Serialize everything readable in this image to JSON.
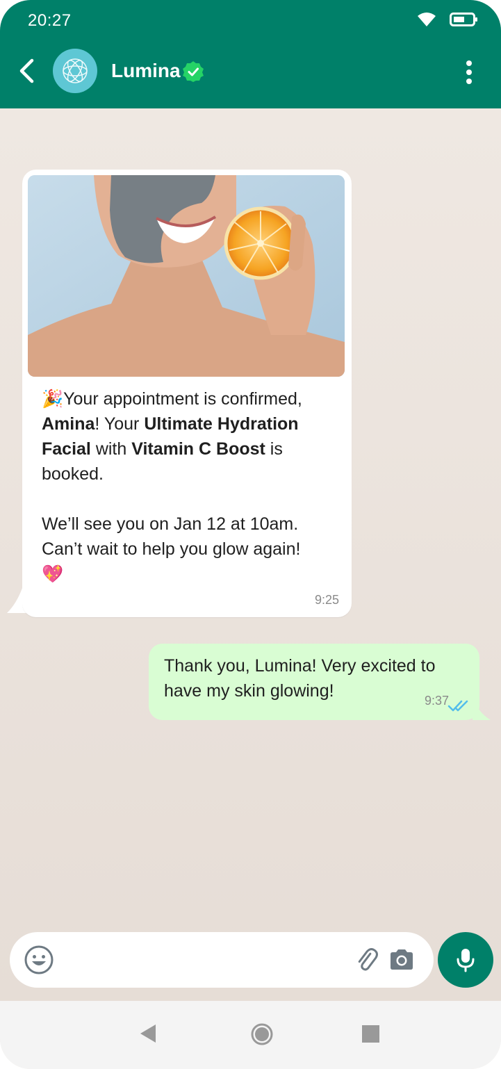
{
  "status_bar": {
    "time": "20:27",
    "icons": [
      "wifi-icon",
      "battery-icon"
    ]
  },
  "header": {
    "contact_name": "Lumina",
    "verified": true,
    "icons": [
      "back-arrow-icon",
      "lumina-logo-icon",
      "verified-badge-icon",
      "more-vertical-icon"
    ]
  },
  "messages": [
    {
      "direction": "incoming",
      "has_image": true,
      "image_description_icon": "woman-orange-face-mask-image",
      "emoji_start": "🎉",
      "line1_pre": "Your appointment is confirmed, ",
      "name": "Amina",
      "line1_mid": "! Your ",
      "service": "Ultimate Hydration Facial",
      "line1_with": " with ",
      "addon": "Vitamin C Boost",
      "line1_end": " is booked.",
      "paragraph2": "We’ll see you on Jan 12 at 10am. Can’t wait to help you glow again!",
      "emoji_end": "💖",
      "time": "9:25"
    },
    {
      "direction": "outgoing",
      "text": "Thank you, Lumina! Very excited to have my skin glowing!",
      "time": "9:37",
      "status": "read"
    }
  ],
  "composer": {
    "placeholder": "",
    "value": "",
    "icons": [
      "emoji-icon",
      "paperclip-icon",
      "camera-icon",
      "microphone-icon"
    ]
  },
  "colors": {
    "header": "#008069",
    "outgoing_bubble": "#d9fdd3",
    "incoming_bubble": "#ffffff",
    "read_ticks": "#53bdeb",
    "verified": "#25d366"
  }
}
